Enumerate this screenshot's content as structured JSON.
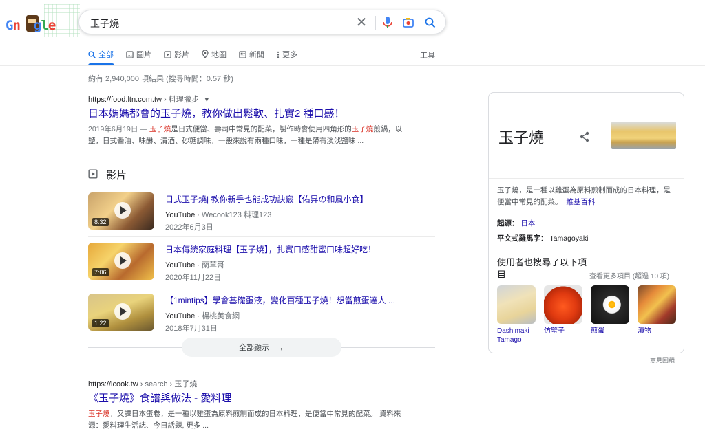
{
  "logo": {
    "letters": [
      "G",
      "n",
      "",
      "g",
      "l",
      "e"
    ]
  },
  "search": {
    "query": "玉子燒"
  },
  "tabs": [
    {
      "label": "全部",
      "icon": "search-icon"
    },
    {
      "label": "圖片",
      "icon": "image-icon"
    },
    {
      "label": "影片",
      "icon": "video-icon"
    },
    {
      "label": "地圖",
      "icon": "map-pin-icon"
    },
    {
      "label": "新聞",
      "icon": "news-icon"
    },
    {
      "label": "更多",
      "icon": "more-vert-icon"
    }
  ],
  "tools_label": "工具",
  "stats": "約有 2,940,000 項結果 (搜尋時間：0.57 秒)",
  "result1": {
    "url": "https://food.ltn.com.tw",
    "crumb": " › 料理撇步",
    "title": "日本媽媽都會的玉子燒，教你做出鬆軟、扎實2 種口感！",
    "date": "2019年6月19日 — ",
    "snippet_parts": [
      "玉子燒",
      "是日式便當、壽司中常見的配菜，製作時會使用四角形的",
      "玉子燒",
      "煎鍋，以鹽，日式醬油、味醂、清酒、砂糖調味，一般來說有兩種口味，一種是帶有淡淡鹽味 ..."
    ]
  },
  "videos": {
    "heading": "影片",
    "items": [
      {
        "title": "日式玉子燒| 教你新手也能成功訣竅【佑昇の和風小食】",
        "source": "YouTube",
        "channel": "Wecook123 料理123",
        "date": "2022年6月3日",
        "duration": "8:32"
      },
      {
        "title": "日本傳統家庭料理【玉子燒】，扎實口感甜蜜口味超好吃！",
        "source": "YouTube",
        "channel": "蘭草哥",
        "date": "2020年11月22日",
        "duration": "7:06"
      },
      {
        "title": "【1mintips】學會基礎蛋液，變化百種玉子燒！想當煎蛋達人 ...",
        "source": "YouTube",
        "channel": "楊桃美食網",
        "date": "2018年7月31日",
        "duration": "1:22"
      }
    ],
    "show_all": "全部顯示"
  },
  "result2": {
    "url": "https://icook.tw",
    "crumb": " › search › 玉子燒",
    "title": "《玉子燒》食譜與做法 - 愛料理",
    "snippet_em": "玉子燒",
    "snippet": "，又譯日本蛋卷，是一種以雞蛋為原料煎制而成的日本料理，是便當中常見的配菜。 資料來源：愛料理生活誌、今日話題, 更多 ..."
  },
  "knowledge_panel": {
    "title": "玉子燒",
    "description": "玉子燒，是一種以雞蛋為原料煎制而成的日本料理，是便當中常見的配菜。",
    "wiki_link": "維基百科",
    "facts": [
      {
        "label": "起源：",
        "value": "日本"
      },
      {
        "label": "平文式羅馬字：",
        "value": "Tamagoyaki"
      }
    ],
    "also_searched": "使用者也搜尋了以下項目",
    "more_link": "查看更多項目 (超過 10 項)",
    "items": [
      {
        "label": "Dashimaki Tamago"
      },
      {
        "label": "仿蟹子"
      },
      {
        "label": "煎蛋"
      },
      {
        "label": "漬物"
      }
    ]
  },
  "feedback": "意見回饋"
}
